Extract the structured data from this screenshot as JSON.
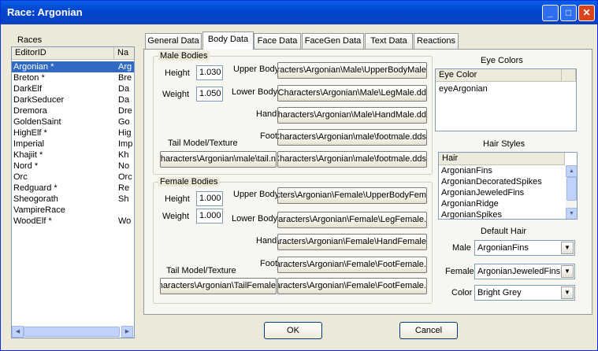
{
  "window": {
    "title": "Race: Argonian"
  },
  "races": {
    "label": "Races",
    "columns": [
      "EditorID",
      "Na"
    ],
    "rows": [
      {
        "id": "Argonian *",
        "name": "Arg"
      },
      {
        "id": "Breton *",
        "name": "Bre"
      },
      {
        "id": "DarkElf",
        "name": "Da"
      },
      {
        "id": "DarkSeducer",
        "name": "Da"
      },
      {
        "id": "Dremora",
        "name": "Dre"
      },
      {
        "id": "GoldenSaint",
        "name": "Go"
      },
      {
        "id": "HighElf *",
        "name": "Hig"
      },
      {
        "id": "Imperial",
        "name": "Imp"
      },
      {
        "id": "Khajiit *",
        "name": "Kh"
      },
      {
        "id": "Nord *",
        "name": "No"
      },
      {
        "id": "Orc",
        "name": "Orc"
      },
      {
        "id": "Redguard *",
        "name": "Re"
      },
      {
        "id": "Sheogorath",
        "name": "Sh"
      },
      {
        "id": "VampireRace",
        "name": ""
      },
      {
        "id": "WoodElf *",
        "name": "Wo"
      }
    ],
    "selected_index": 0
  },
  "tabs": [
    "General Data",
    "Body Data",
    "Face Data",
    "FaceGen Data",
    "Text Data",
    "Reactions"
  ],
  "active_tab": "Body Data",
  "male": {
    "group_label": "Male Bodies",
    "height_label": "Height",
    "height": "1.030",
    "weight_label": "Weight",
    "weight": "1.050",
    "upper_body_label": "Upper Body",
    "upper_body": "Characters\\Argonian\\Male\\UpperBodyMale",
    "lower_body_label": "Lower Body",
    "lower_body": "Characters\\Argonian\\Male\\LegMale.dd",
    "hand_label": "Hand",
    "hand": "Characters\\Argonian\\Male\\HandMale.dd",
    "foot_label": "Foot",
    "foot": "Characters\\Argonian\\male\\footmale.dds",
    "tail_label": "Tail Model/Texture",
    "tail_model": "Characters\\Argonian\\male\\tail.n",
    "tail_texture": "Characters\\Argonian\\male\\footmale.dds"
  },
  "female": {
    "group_label": "Female Bodies",
    "height_label": "Height",
    "height": "1.000",
    "weight_label": "Weight",
    "weight": "1.000",
    "upper_body_label": "Upper Body",
    "upper_body": "Characters\\Argonian\\Female\\UpperBodyFem",
    "lower_body_label": "Lower Body",
    "lower_body": "Characters\\Argonian\\Female\\LegFemale.",
    "hand_label": "Hand",
    "hand": "Characters\\Argonian\\Female\\HandFemale",
    "foot_label": "Foot",
    "foot": "Characters\\Argonian\\Female\\FootFemale.",
    "tail_label": "Tail Model/Texture",
    "tail_model": "Characters\\Argonian\\TailFemale",
    "tail_texture": "Characters\\Argonian\\Female\\FootFemale."
  },
  "eye_colors": {
    "label": "Eye Colors",
    "column": "Eye Color",
    "items": [
      "eyeArgonian"
    ]
  },
  "hair_styles": {
    "label": "Hair Styles",
    "column": "Hair",
    "items": [
      "ArgonianFins",
      "ArgonianDecoratedSpikes",
      "ArgonianJeweledFins",
      "ArgonianRidge",
      "ArgonianSpikes"
    ]
  },
  "default_hair": {
    "label": "Default Hair",
    "male_label": "Male",
    "male": "ArgonianFins",
    "female_label": "Female",
    "female": "ArgonianJeweledFins",
    "color_label": "Color",
    "color": "Bright Grey"
  },
  "buttons": {
    "ok": "OK",
    "cancel": "Cancel"
  }
}
